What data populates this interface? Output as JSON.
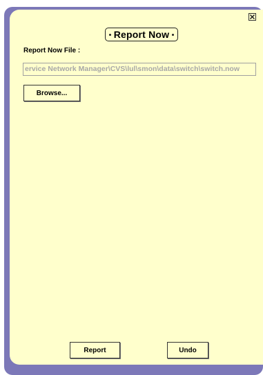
{
  "dialog": {
    "title": "Report Now",
    "close_icon": "close-x-icon"
  },
  "form": {
    "file_label": "Report Now File :",
    "file_value": "ervice Network Manager\\CVS\\lul\\smon\\data\\switch\\switch.now",
    "browse_label": "Browse..."
  },
  "actions": {
    "report_label": "Report",
    "undo_label": "Undo"
  },
  "colors": {
    "panel_bg": "#ffffcc",
    "frame": "#7c78b8"
  }
}
